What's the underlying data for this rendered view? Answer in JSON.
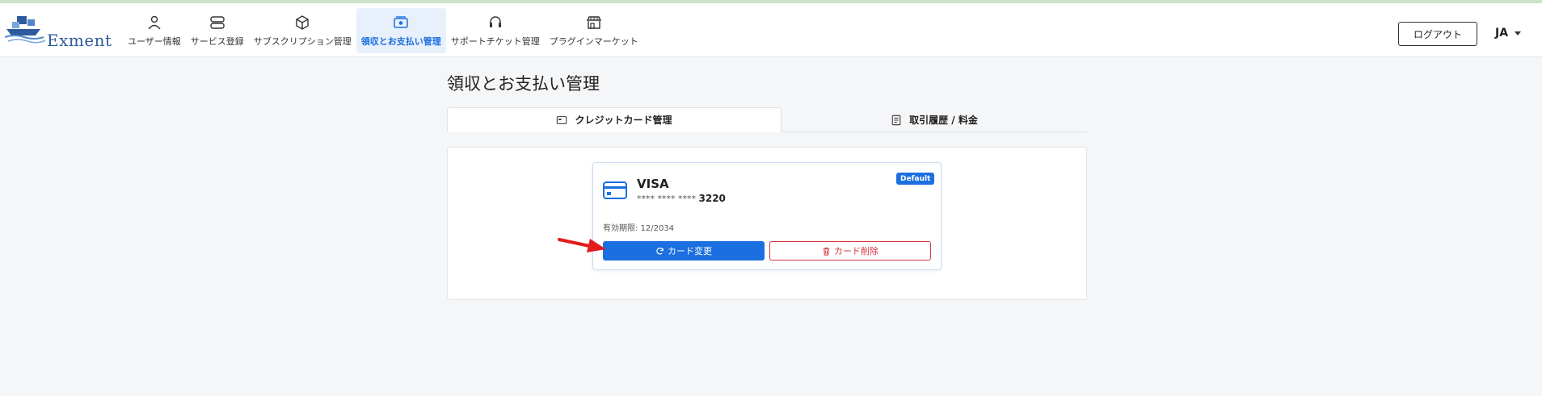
{
  "app": {
    "logo_text": "Exment"
  },
  "nav": {
    "items": [
      {
        "label": "ユーザー情報",
        "icon": "user-icon",
        "active": false
      },
      {
        "label": "サービス登録",
        "icon": "server-icon",
        "active": false
      },
      {
        "label": "サブスクリプション管理",
        "icon": "box-icon",
        "active": false
      },
      {
        "label": "領収とお支払い管理",
        "icon": "cash-icon",
        "active": true
      },
      {
        "label": "サポートチケット管理",
        "icon": "headset-icon",
        "active": false
      },
      {
        "label": "プラグインマーケット",
        "icon": "shop-icon",
        "active": false
      }
    ],
    "logout_label": "ログアウト",
    "language": "JA"
  },
  "page": {
    "title": "領収とお支払い管理",
    "tabs": [
      {
        "label": "クレジットカード管理",
        "icon": "credit-card-icon",
        "active": true
      },
      {
        "label": "取引履歴 / 料金",
        "icon": "receipt-icon",
        "active": false
      }
    ]
  },
  "card": {
    "brand": "VISA",
    "masked_prefix": "**** **** ****",
    "last4": "3220",
    "badge": "Default",
    "expiry": "有効期限: 12/2034",
    "change_label": "カード変更",
    "delete_label": "カード削除"
  },
  "colors": {
    "primary": "#1b6fe0",
    "danger": "#d9343f",
    "annotation_arrow": "#e21b1b"
  }
}
